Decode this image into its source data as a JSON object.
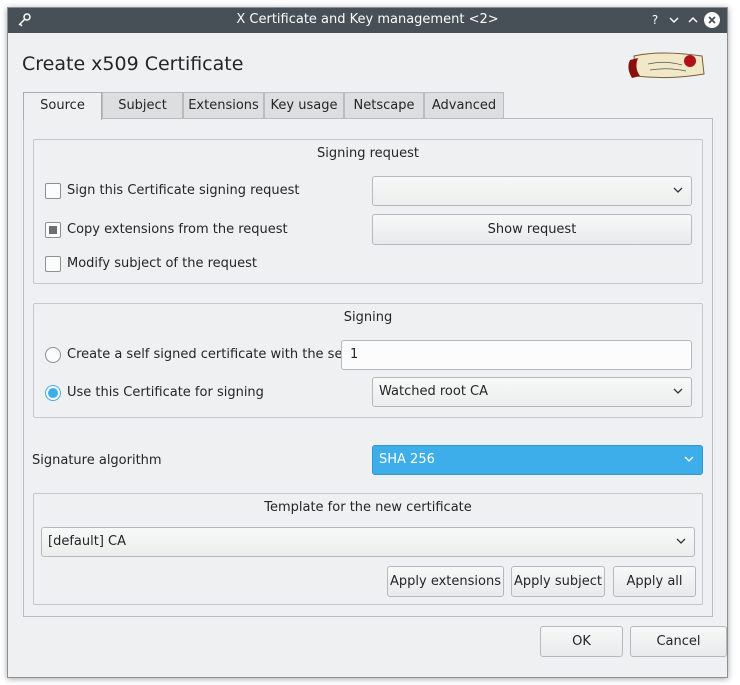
{
  "window": {
    "title": "X Certificate and Key management <2>",
    "buttons": {
      "help": "?",
      "minimize": "⌄",
      "maximize": "⌃",
      "close": "✕"
    }
  },
  "dialog": {
    "title": "Create x509 Certificate"
  },
  "tabs": [
    "Source",
    "Subject",
    "Extensions",
    "Key usage",
    "Netscape",
    "Advanced"
  ],
  "signing_request": {
    "title": "Signing request",
    "sign_label": "Sign this Certificate signing request",
    "sign_checked": false,
    "request_select_value": "",
    "copy_label": "Copy extensions from the request",
    "copy_state": "partial",
    "show_request_label": "Show request",
    "modify_label": "Modify subject of the request",
    "modify_checked": false
  },
  "signing": {
    "title": "Signing",
    "self_signed_label": "Create a self signed certificate with the serial",
    "serial_value": "1",
    "use_cert_label": "Use this Certificate for signing",
    "use_cert_selected": true,
    "ca_value": "Watched root CA"
  },
  "signature": {
    "label": "Signature algorithm",
    "value": "SHA 256"
  },
  "template": {
    "title": "Template for the new certificate",
    "value": "[default] CA",
    "apply_extensions": "Apply extensions",
    "apply_subject": "Apply subject",
    "apply_all": "Apply all"
  },
  "footer": {
    "ok": "OK",
    "cancel": "Cancel"
  },
  "colors": {
    "accent": "#3daee9",
    "titlebar": "#475057",
    "window_bg": "#eff0f1"
  },
  "icons": {
    "app": "certificate-key-icon",
    "combo": "chevron-down-icon",
    "logo": "scroll-seal-logo"
  }
}
